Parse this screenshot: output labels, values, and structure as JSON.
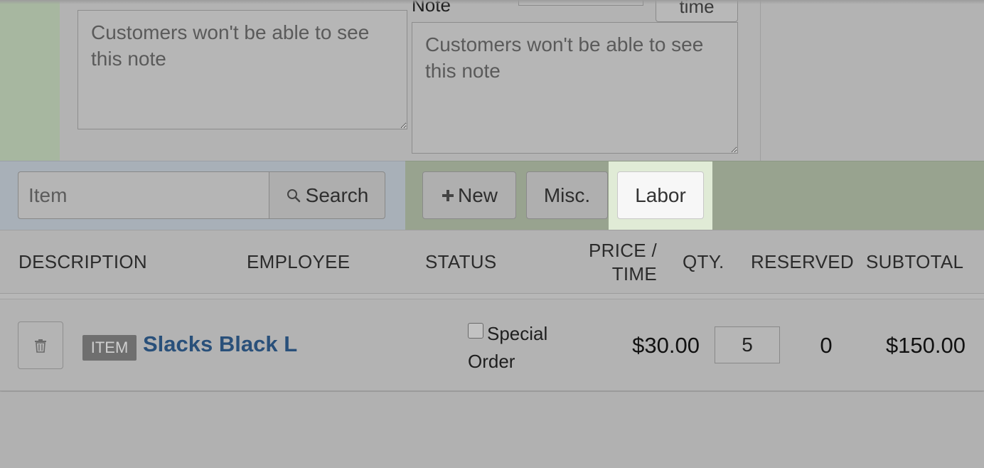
{
  "notes": {
    "note_label": "Note",
    "time_button_label": "time",
    "note1_placeholder": "Customers won't be able to see this note",
    "note2_placeholder": "Customers won't be able to see this note"
  },
  "toolbar": {
    "item_placeholder": "Item",
    "search_label": "Search",
    "new_label": "New",
    "misc_label": "Misc.",
    "labor_label": "Labor"
  },
  "table": {
    "headers": {
      "description": "DESCRIPTION",
      "employee": "EMPLOYEE",
      "status": "STATUS",
      "price_line1": "PRICE /",
      "price_line2": "TIME",
      "qty": "QTY.",
      "reserved": "RESERVED",
      "subtotal": "SUBTOTAL"
    },
    "rows": [
      {
        "badge": "ITEM",
        "name": "Slacks Black L",
        "status_checkbox_label": "Special Order",
        "price": "$30.00",
        "qty": "5",
        "reserved": "0",
        "subtotal": "$150.00"
      }
    ]
  },
  "colors": {
    "link": "#29507a",
    "labor_highlight": "#e0ebd6",
    "search_area": "#a8b0b8",
    "buttons_area": "#98a38f"
  }
}
